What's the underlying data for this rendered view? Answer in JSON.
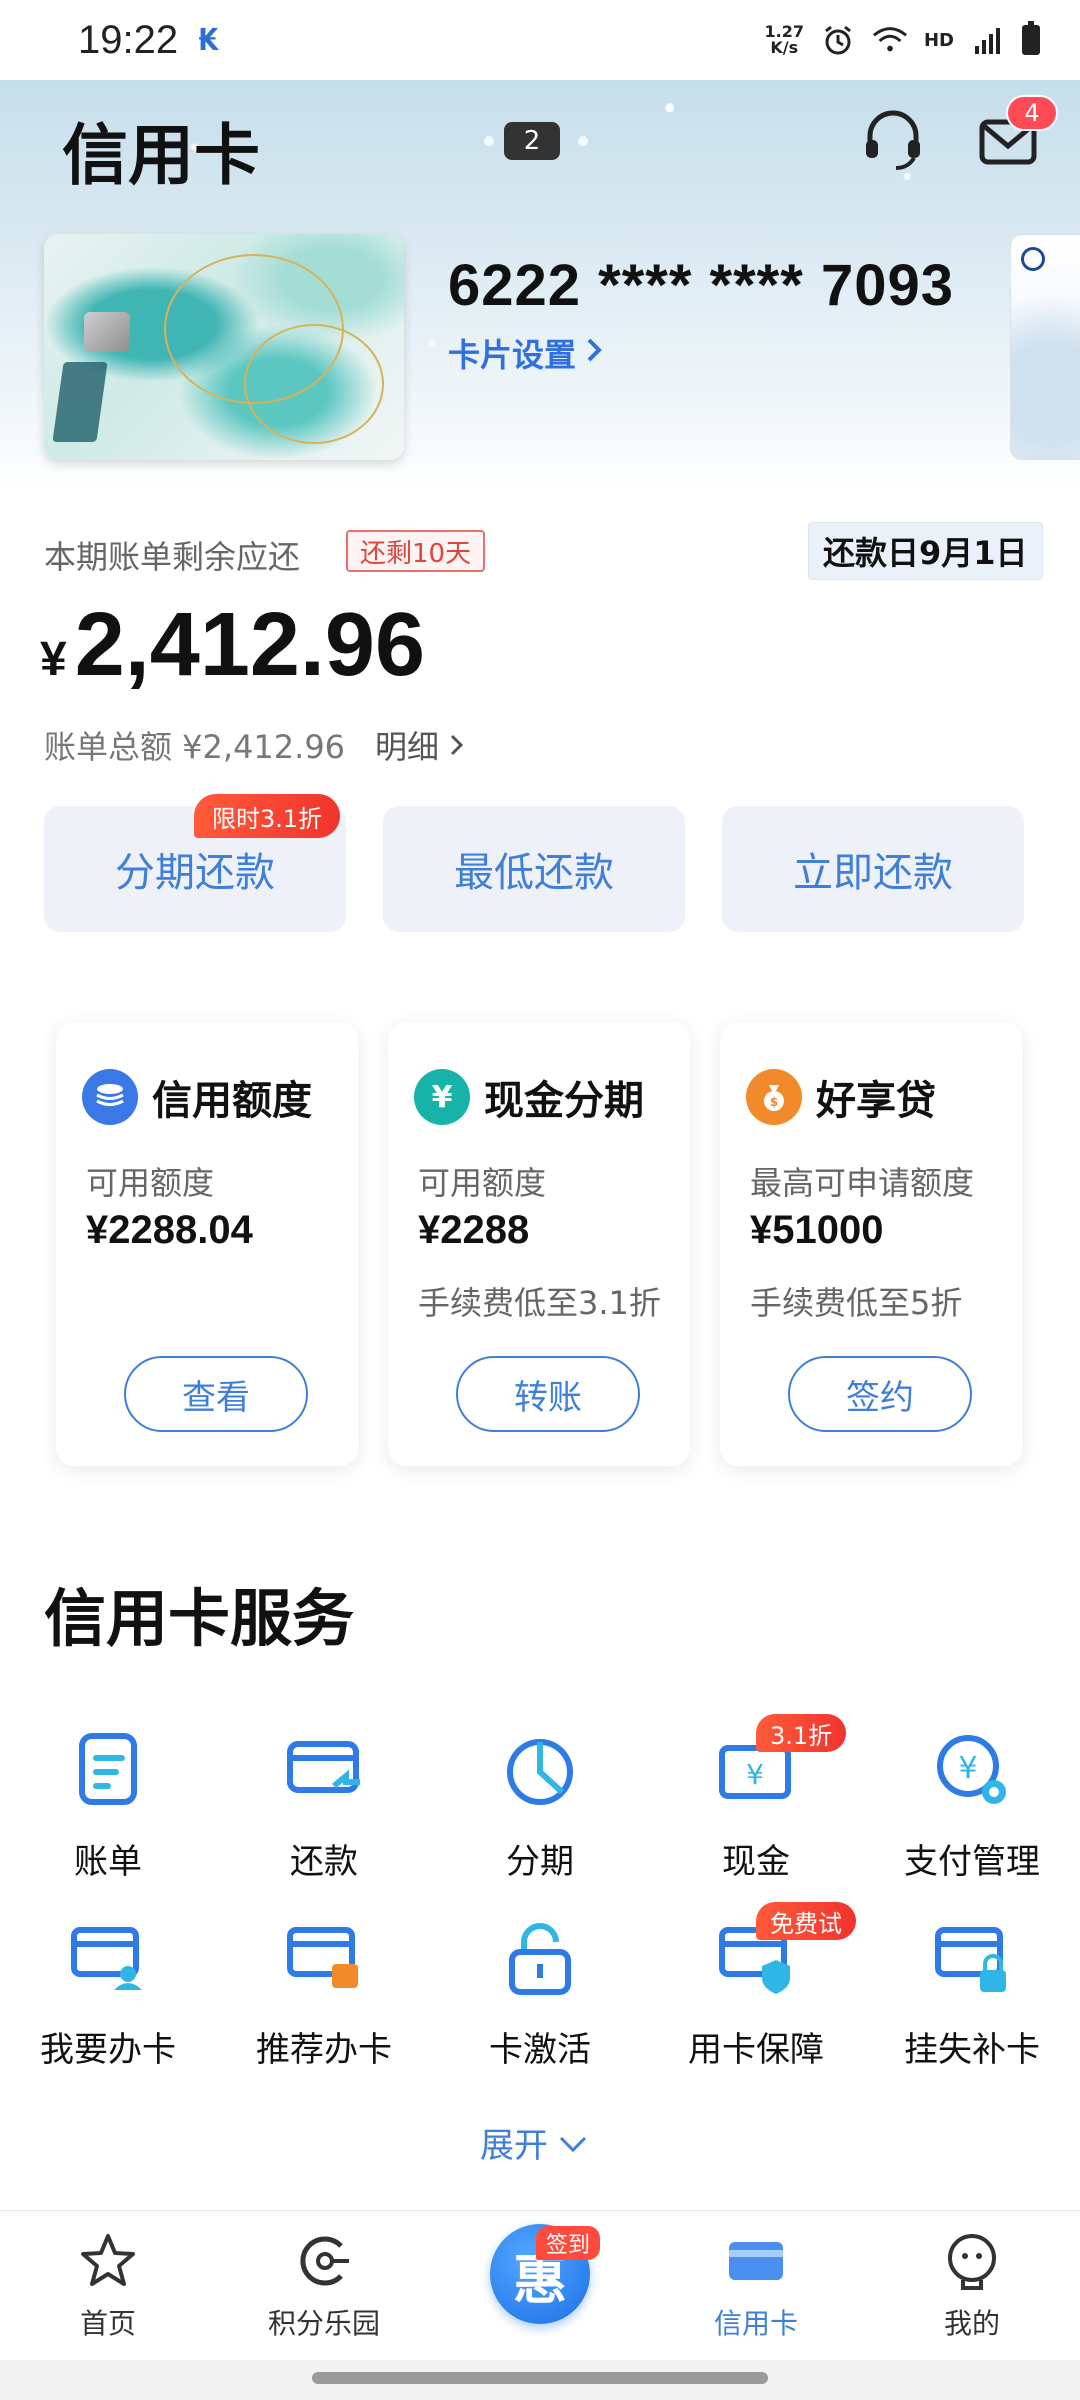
{
  "status_bar": {
    "time": "19:22",
    "app_icon": "bank-notification-icon",
    "speed_value": "1.27",
    "speed_unit": "K/s",
    "hd": "HD",
    "network": "4G"
  },
  "header": {
    "title": "信用卡",
    "page_indicator": "2",
    "mail_badge": "4",
    "icons": [
      "customer-service-icon",
      "mail-icon"
    ]
  },
  "card": {
    "number": "6222 **** **** 7093",
    "settings_label": "卡片设置"
  },
  "bill": {
    "label": "本期账单剩余应还",
    "days_left": "还剩10天",
    "due_date": "还款日9月1日",
    "currency": "¥",
    "amount": "2,412.96",
    "total_label": "账单总额 ¥2,412.96",
    "detail_link": "明细"
  },
  "repay_actions": {
    "installment": "分期还款",
    "installment_promo": "限时3.1折",
    "minimum": "最低还款",
    "pay_now": "立即还款"
  },
  "features": [
    {
      "name": "信用额度",
      "icon": "coins-icon",
      "sub": "可用额度",
      "value": "¥2288.04",
      "fee": "",
      "button": "查看",
      "color": "#3a78e6"
    },
    {
      "name": "现金分期",
      "icon": "yen-icon",
      "sub": "可用额度",
      "value": "¥2288",
      "fee": "手续费低至3.1折",
      "button": "转账",
      "color": "#18b3a8"
    },
    {
      "name": "好享贷",
      "icon": "money-bag-icon",
      "sub": "最高可申请额度",
      "value": "¥51000",
      "fee": "手续费低至5折",
      "button": "签约",
      "color": "#f08a2a"
    }
  ],
  "services": {
    "title": "信用卡服务",
    "items": [
      {
        "label": "账单",
        "icon": "bill-icon"
      },
      {
        "label": "还款",
        "icon": "repay-icon"
      },
      {
        "label": "分期",
        "icon": "installment-icon"
      },
      {
        "label": "现金",
        "icon": "cash-icon",
        "tag": "3.1折"
      },
      {
        "label": "支付管理",
        "icon": "payment-settings-icon"
      },
      {
        "label": "我要办卡",
        "icon": "apply-card-icon"
      },
      {
        "label": "推荐办卡",
        "icon": "recommend-card-icon"
      },
      {
        "label": "卡激活",
        "icon": "unlock-icon"
      },
      {
        "label": "用卡保障",
        "icon": "card-shield-icon",
        "tag": "免费试"
      },
      {
        "label": "挂失补卡",
        "icon": "card-lock-icon"
      }
    ],
    "expand_label": "展开"
  },
  "tabbar": {
    "items": [
      {
        "label": "首页",
        "icon": "star-icon"
      },
      {
        "label": "积分乐园",
        "icon": "points-icon"
      },
      {
        "label": "",
        "icon": "center-promo-icon"
      },
      {
        "label": "信用卡",
        "icon": "credit-card-icon",
        "active": true
      },
      {
        "label": "我的",
        "icon": "profile-icon"
      }
    ],
    "center_badge": "签到",
    "center_glyph": "惠"
  },
  "colors": {
    "accent": "#3f7fd9",
    "promo_red": "#f0342d"
  }
}
